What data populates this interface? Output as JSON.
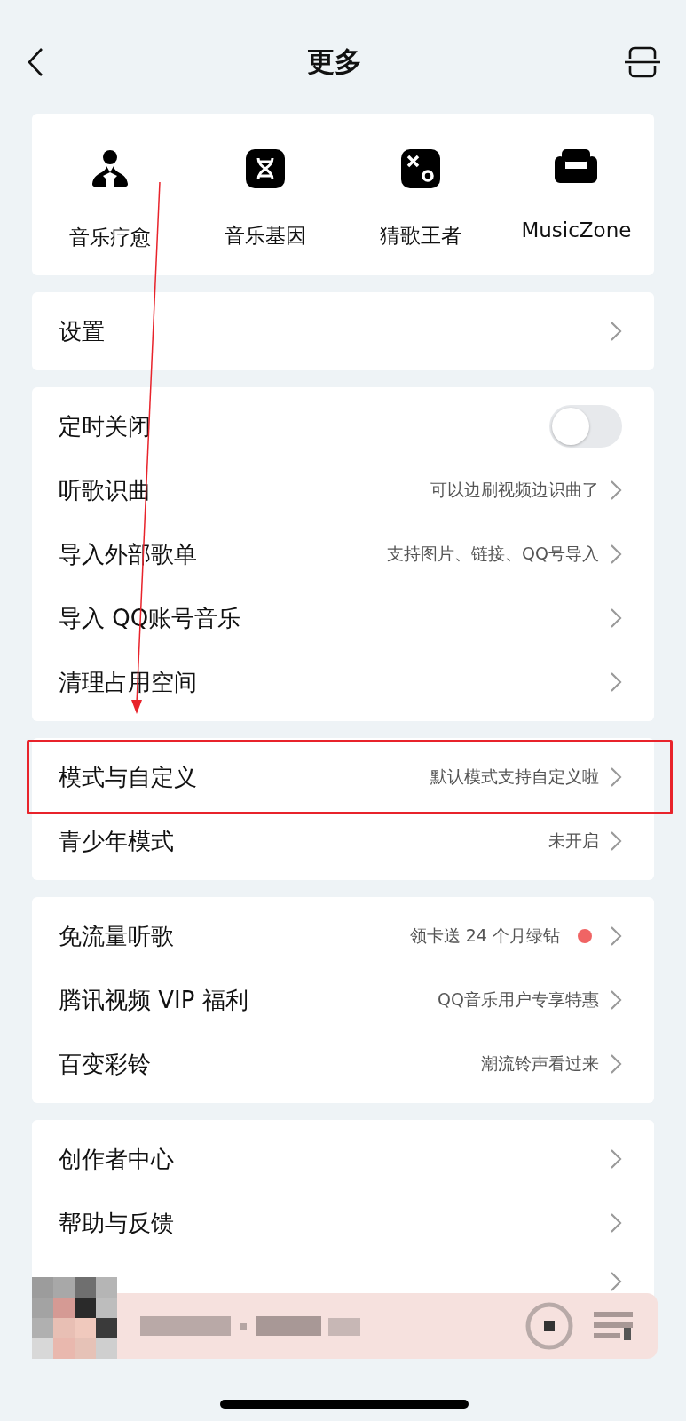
{
  "header": {
    "title": "更多"
  },
  "shortcuts": [
    {
      "kind": "healing",
      "label": "音乐疗愈"
    },
    {
      "kind": "dna",
      "label": "音乐基因"
    },
    {
      "kind": "game",
      "label": "猜歌王者"
    },
    {
      "kind": "sofa",
      "label": "MusicZone"
    }
  ],
  "groups": [
    {
      "rows": [
        {
          "kind": "link",
          "label": "设置"
        }
      ]
    },
    {
      "rows": [
        {
          "kind": "switch",
          "label": "定时关闭",
          "on": false
        },
        {
          "kind": "link",
          "label": "听歌识曲",
          "hint": "可以边刷视频边识曲了"
        },
        {
          "kind": "link",
          "label": "导入外部歌单",
          "hint": "支持图片、链接、QQ号导入"
        },
        {
          "kind": "link",
          "label": "导入 QQ账号音乐"
        },
        {
          "kind": "link",
          "label": "清理占用空间"
        }
      ]
    },
    {
      "rows": [
        {
          "kind": "link",
          "label": "模式与自定义",
          "hint": "默认模式支持自定义啦",
          "highlighted": true
        },
        {
          "kind": "link",
          "label": "青少年模式",
          "hint": "未开启"
        }
      ]
    },
    {
      "rows": [
        {
          "kind": "link",
          "label": "免流量听歌",
          "hint": "领卡送 24 个月绿钻",
          "notice_dot": true
        },
        {
          "kind": "link",
          "label": "腾讯视频 VIP 福利",
          "hint": "QQ音乐用户专享特惠"
        },
        {
          "kind": "link",
          "label": "百变彩铃",
          "hint": "潮流铃声看过来"
        }
      ]
    },
    {
      "rows": [
        {
          "kind": "link",
          "label": "创作者中心"
        },
        {
          "kind": "link",
          "label": "帮助与反馈"
        },
        {
          "kind": "link"
        }
      ]
    }
  ],
  "mini_player": {
    "kind": "blurred"
  }
}
